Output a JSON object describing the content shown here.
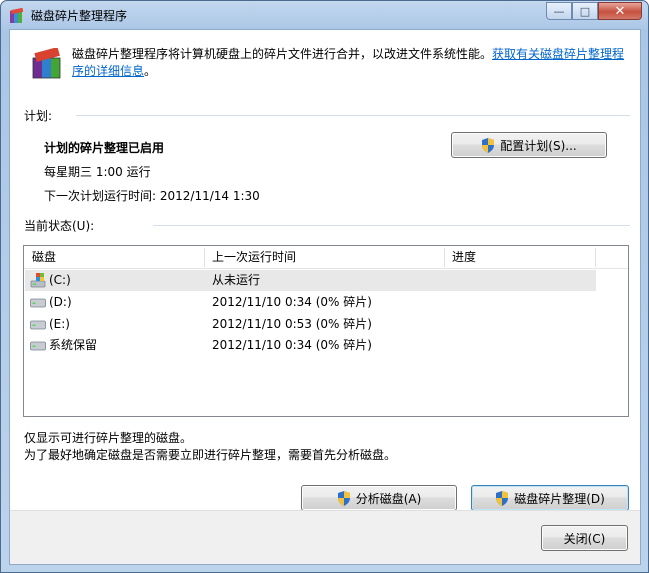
{
  "window": {
    "title": "磁盘碎片整理程序",
    "caption": {
      "minimize": "—",
      "maximize": "□",
      "close": "✕"
    }
  },
  "description": {
    "text": "磁盘碎片整理程序将计算机硬盘上的碎片文件进行合并，以改进文件系统性能。",
    "link_line1": "获取有关磁盘碎片整理程",
    "link_line2": "序的详细信息",
    "period": "。"
  },
  "schedule": {
    "section_label": "计划:",
    "status": "计划的碎片整理已启用",
    "frequency": "每星期三  1:00 运行",
    "next_run": "下一次计划运行时间: 2012/11/14 1:30",
    "configure_button": "配置计划(S)..."
  },
  "current_status": {
    "section_label": "当前状态(U):",
    "columns": {
      "disk": "磁盘",
      "last_run": "上一次运行时间",
      "progress": "进度"
    },
    "rows": [
      {
        "disk": "(C:)",
        "last_run": "从未运行",
        "progress": "",
        "icon": "system-drive-icon"
      },
      {
        "disk": "(D:)",
        "last_run": "2012/11/10 0:34 (0% 碎片)",
        "progress": "",
        "icon": "drive-icon"
      },
      {
        "disk": "(E:)",
        "last_run": "2012/11/10 0:53 (0% 碎片)",
        "progress": "",
        "icon": "drive-icon"
      },
      {
        "disk": "系统保留",
        "last_run": "2012/11/10 0:34 (0% 碎片)",
        "progress": "",
        "icon": "drive-icon"
      }
    ]
  },
  "notes": {
    "line1": "仅显示可进行碎片整理的磁盘。",
    "line2": "为了最好地确定磁盘是否需要立即进行碎片整理，需要首先分析磁盘。"
  },
  "actions": {
    "analyze_button": "分析磁盘(A)",
    "defrag_button": "磁盘碎片整理(D)",
    "close_button": "关闭(C)"
  },
  "colors": {
    "link": "#0066cc",
    "selected_row": "#e8e8e8",
    "accent_border": "#3c7fb1"
  }
}
